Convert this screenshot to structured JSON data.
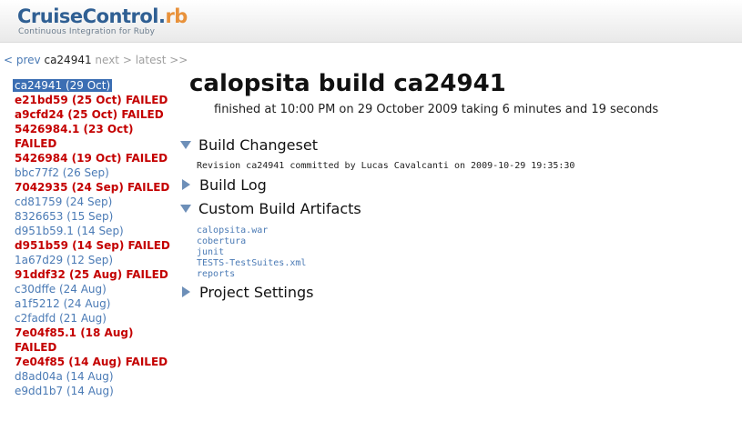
{
  "header": {
    "logo_main": "CruiseControl.",
    "logo_ext": "rb",
    "tagline": "Continuous Integration for Ruby"
  },
  "nav": {
    "prev": "< prev",
    "current": "ca24941",
    "next": "next >",
    "latest": "latest >>"
  },
  "builds": [
    {
      "id": "ca24941",
      "label": "ca24941 (29 Oct)",
      "status": "selected"
    },
    {
      "id": "e21bd59",
      "label": "e21bd59 (25 Oct) FAILED",
      "status": "failed"
    },
    {
      "id": "a9cfd24",
      "label": "a9cfd24 (25 Oct) FAILED",
      "status": "failed"
    },
    {
      "id": "5426984.1",
      "label": "5426984.1 (23 Oct)",
      "status": "failed"
    },
    {
      "id": "5426984.1-cont",
      "label": "FAILED",
      "status": "failed"
    },
    {
      "id": "5426984",
      "label": "5426984 (19 Oct) FAILED",
      "status": "failed"
    },
    {
      "id": "bbc77f2",
      "label": "bbc77f2 (26 Sep)",
      "status": "ok"
    },
    {
      "id": "7042935",
      "label": "7042935 (24 Sep) FAILED",
      "status": "failed"
    },
    {
      "id": "cd81759",
      "label": "cd81759 (24 Sep)",
      "status": "ok"
    },
    {
      "id": "8326653",
      "label": "8326653 (15 Sep)",
      "status": "ok"
    },
    {
      "id": "d951b59.1",
      "label": "d951b59.1 (14 Sep)",
      "status": "ok"
    },
    {
      "id": "d951b59",
      "label": "d951b59 (14 Sep) FAILED",
      "status": "failed"
    },
    {
      "id": "1a67d29",
      "label": "1a67d29 (12 Sep)",
      "status": "ok"
    },
    {
      "id": "91ddf32",
      "label": "91ddf32 (25 Aug) FAILED",
      "status": "failed"
    },
    {
      "id": "c30dffe",
      "label": "c30dffe (24 Aug)",
      "status": "ok"
    },
    {
      "id": "a1f5212",
      "label": "a1f5212 (24 Aug)",
      "status": "ok"
    },
    {
      "id": "c2fadfd",
      "label": "c2fadfd (21 Aug)",
      "status": "ok"
    },
    {
      "id": "7e04f85.1",
      "label": "7e04f85.1 (18 Aug)",
      "status": "failed"
    },
    {
      "id": "7e04f85.1-cont",
      "label": "FAILED",
      "status": "failed"
    },
    {
      "id": "7e04f85",
      "label": "7e04f85 (14 Aug) FAILED",
      "status": "failed"
    },
    {
      "id": "d8ad04a",
      "label": "d8ad04a (14 Aug)",
      "status": "ok"
    },
    {
      "id": "e9dd1b7",
      "label": "e9dd1b7 (14 Aug)",
      "status": "ok"
    }
  ],
  "main": {
    "title": "calopsita build ca24941",
    "finished": "finished at 10:00 PM on 29 October 2009 taking 6 minutes and 19 seconds",
    "changeset_label": "Build Changeset",
    "revision": "Revision ca24941 committed by Lucas Cavalcanti on 2009-10-29 19:35:30",
    "build_log_label": "Build Log",
    "artifacts_label": "Custom Build Artifacts",
    "artifacts": [
      "calopsita.war",
      "cobertura",
      "junit",
      "TESTS-TestSuites.xml",
      "reports"
    ],
    "settings_label": "Project Settings"
  },
  "colors": {
    "link": "#4a7ab5",
    "failed": "#c40000",
    "selected_bg": "#3b6eb3",
    "logo_blue": "#2f5f93",
    "logo_orange": "#e8913a",
    "triangle": "#6d8fb8"
  },
  "icons": {
    "expanded": "triangle-down-icon",
    "collapsed": "triangle-right-icon"
  }
}
